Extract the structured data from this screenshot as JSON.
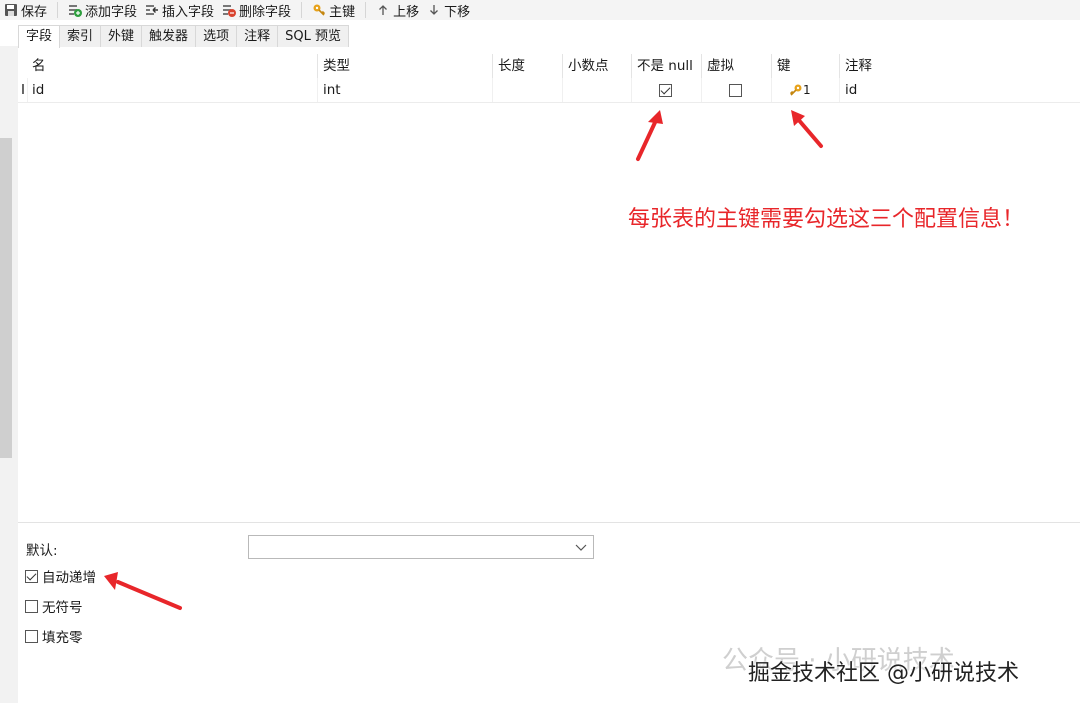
{
  "toolbar": {
    "save": "保存",
    "add_field": "添加字段",
    "insert_field": "插入字段",
    "delete_field": "删除字段",
    "primary_key": "主键",
    "move_up": "上移",
    "move_down": "下移"
  },
  "tabs": [
    "字段",
    "索引",
    "外键",
    "触发器",
    "选项",
    "注释",
    "SQL 预览"
  ],
  "columns": [
    "名",
    "类型",
    "长度",
    "小数点",
    "不是 null",
    "虚拟",
    "键",
    "注释"
  ],
  "rows": [
    {
      "cursor": "I",
      "name": "id",
      "type": "int",
      "length": "",
      "decimals": "",
      "not_null": true,
      "virtual": false,
      "key": "1",
      "comment": "id"
    }
  ],
  "bottom": {
    "default_label": "默认:",
    "default_value": "",
    "auto_increment": {
      "label": "自动递增",
      "checked": true
    },
    "unsigned": {
      "label": "无符号",
      "checked": false
    },
    "zerofill": {
      "label": "填充零",
      "checked": false
    }
  },
  "annotation": "每张表的主键需要勾选这三个配置信息！",
  "watermark": {
    "faint": "公众号 · 小研说技术",
    "main": "掘金技术社区 @小研说技术"
  },
  "colors": {
    "annotation_red": "#e8262a",
    "key_icon": "#e7a21b",
    "add_icon": "#2e9e3e",
    "delete_icon": "#d9432f"
  }
}
